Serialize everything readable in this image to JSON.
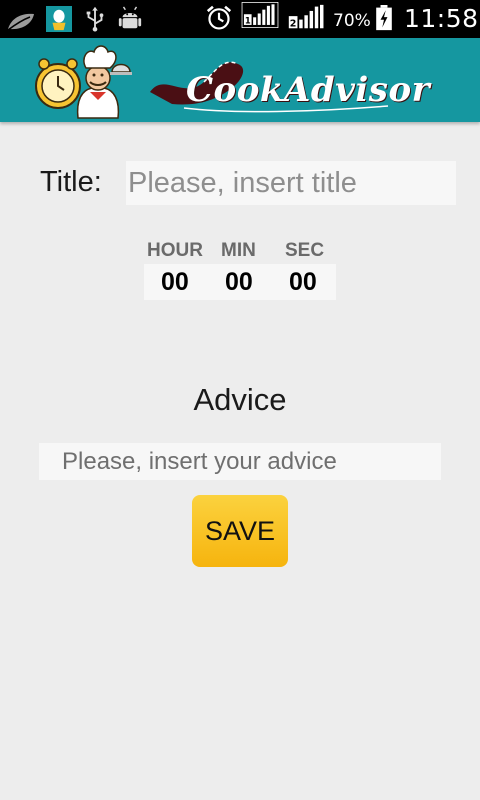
{
  "status_bar": {
    "battery_percent": "70%",
    "time": "11:58",
    "icons": [
      "leaf-icon",
      "egg-timer-app-icon",
      "usb-icon",
      "android-debug-icon",
      "alarm-clock-icon",
      "signal-sim1-icon",
      "signal-sim2-icon",
      "battery-charging-icon"
    ],
    "sim1_label": "1",
    "sim2_label": "2"
  },
  "action_bar": {
    "brand_name": "CookAdvisor",
    "background_color": "#1597a0"
  },
  "form": {
    "title_label": "Title:",
    "title_value": "",
    "title_placeholder": "Please, insert title",
    "timer": {
      "hour_label": "HOUR",
      "min_label": "MIN",
      "sec_label": "SEC",
      "hour_value": "00",
      "min_value": "00",
      "sec_value": "00"
    },
    "advice_heading": "Advice",
    "advice_value": "",
    "advice_placeholder": "Please, insert your advice",
    "save_label": "SAVE",
    "save_color": "#f8c225"
  }
}
